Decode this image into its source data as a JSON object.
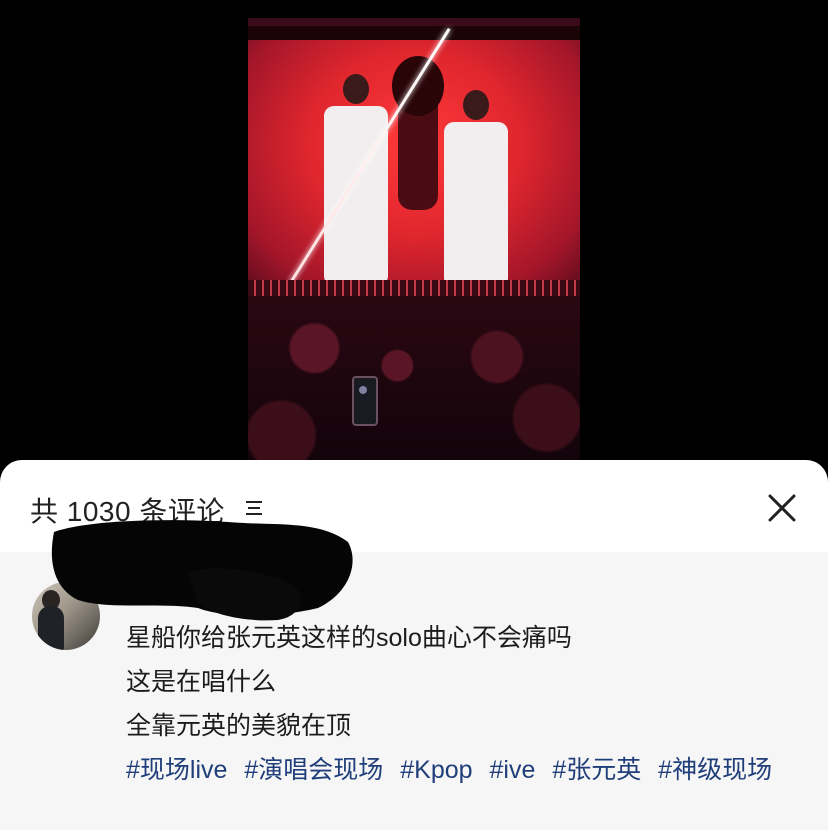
{
  "comments_panel": {
    "count_label": "共 1030 条评论",
    "sort_icon": "sort-lines-icon",
    "close_icon": "close-x-icon"
  },
  "post": {
    "lines": [
      "星船你给张元英这样的solo曲心不会痛吗",
      "这是在唱什么",
      "全靠元英的美貌在顶"
    ],
    "hashtags": [
      "#现场live",
      "#演唱会现场",
      "#Kpop",
      "#ive",
      "#张元英",
      "#神级现场"
    ]
  },
  "colors": {
    "hashtag": "#203f7a",
    "stage_red": "#e0262e"
  }
}
